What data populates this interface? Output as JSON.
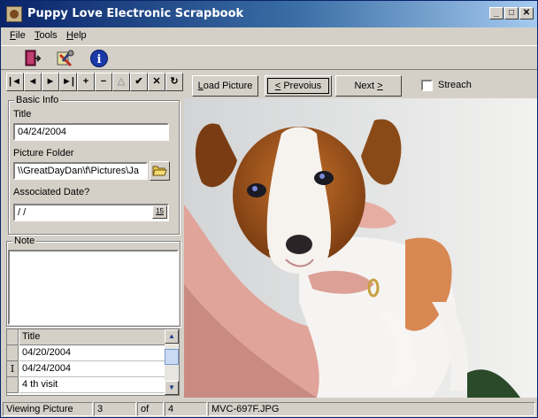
{
  "window": {
    "title": "Puppy Love Electronic Scrapbook",
    "minimize": "_",
    "maximize": "□",
    "close": "✕"
  },
  "menu": [
    {
      "pre": "",
      "u": "F",
      "post": "ile"
    },
    {
      "pre": "",
      "u": "T",
      "post": "ools"
    },
    {
      "pre": "",
      "u": "H",
      "post": "elp"
    }
  ],
  "toolbar": {
    "icons": [
      "exit-door-icon",
      "tools-settings-icon",
      "info-icon"
    ],
    "info_glyph": "i"
  },
  "navigator": {
    "buttons": [
      {
        "name": "first-record-button",
        "glyph": "|◄"
      },
      {
        "name": "prior-record-button",
        "glyph": "◄"
      },
      {
        "name": "next-record-button",
        "glyph": "►"
      },
      {
        "name": "last-record-button",
        "glyph": "►|"
      },
      {
        "name": "insert-record-button",
        "glyph": "+"
      },
      {
        "name": "delete-record-button",
        "glyph": "−"
      },
      {
        "name": "edit-record-button",
        "glyph": "△"
      },
      {
        "name": "post-record-button",
        "glyph": "✔"
      },
      {
        "name": "cancel-record-button",
        "glyph": "✕"
      },
      {
        "name": "refresh-record-button",
        "glyph": "↻"
      }
    ]
  },
  "basic_info": {
    "caption": "Basic Info",
    "title_label": "Title",
    "title_value": "04/24/2004",
    "folder_label": "Picture Folder",
    "folder_value": "\\\\GreatDayDan\\f\\Pictures\\Ja",
    "date_label": "Associated Date?",
    "date_value": " /  /",
    "calendar_glyph": "15"
  },
  "note": {
    "caption": "Note",
    "value": ""
  },
  "grid": {
    "column": "Title",
    "rows": [
      {
        "indicator": "",
        "title": "04/20/2004"
      },
      {
        "indicator": "I",
        "title": "04/24/2004"
      },
      {
        "indicator": "",
        "title": "4 th visit"
      }
    ]
  },
  "buttons": {
    "load_pre": "",
    "load_u": "L",
    "load_post": "oad Picture",
    "prev_pre": "",
    "prev_u": "<",
    "prev_post": " Prevoius",
    "next_pre": "Next ",
    "next_u": ">",
    "next_post": "",
    "stretch_label": "Streach",
    "stretch_checked": false
  },
  "status": {
    "mode": "Viewing Picture",
    "current": "3",
    "of": "of",
    "total": "4",
    "filename": "MVC-697F.JPG"
  },
  "colors": {
    "titlebar_start": "#0a246a",
    "titlebar_end": "#a6caf0",
    "face": "#d4d0c8"
  }
}
